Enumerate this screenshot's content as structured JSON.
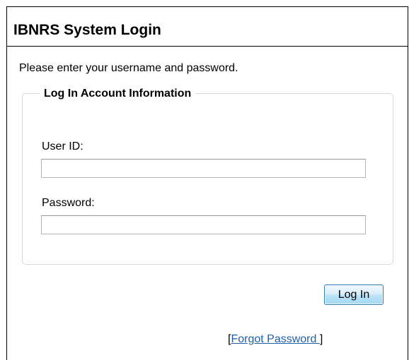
{
  "page": {
    "title": "IBNRS System Login",
    "instructions": "Please enter your username and password."
  },
  "login_form": {
    "legend": "Log In Account Information",
    "user_id_label": "User ID:",
    "user_id_value": "",
    "password_label": "Password:",
    "password_value": "",
    "submit_label": "Log In"
  },
  "forgot_password": {
    "open_bracket": "[",
    "link_text": "Forgot Password ",
    "close_bracket": "]"
  },
  "colors": {
    "link": "#1f5fa8",
    "button_border": "#3c7fb1",
    "button_fill": "#bde3f8"
  }
}
